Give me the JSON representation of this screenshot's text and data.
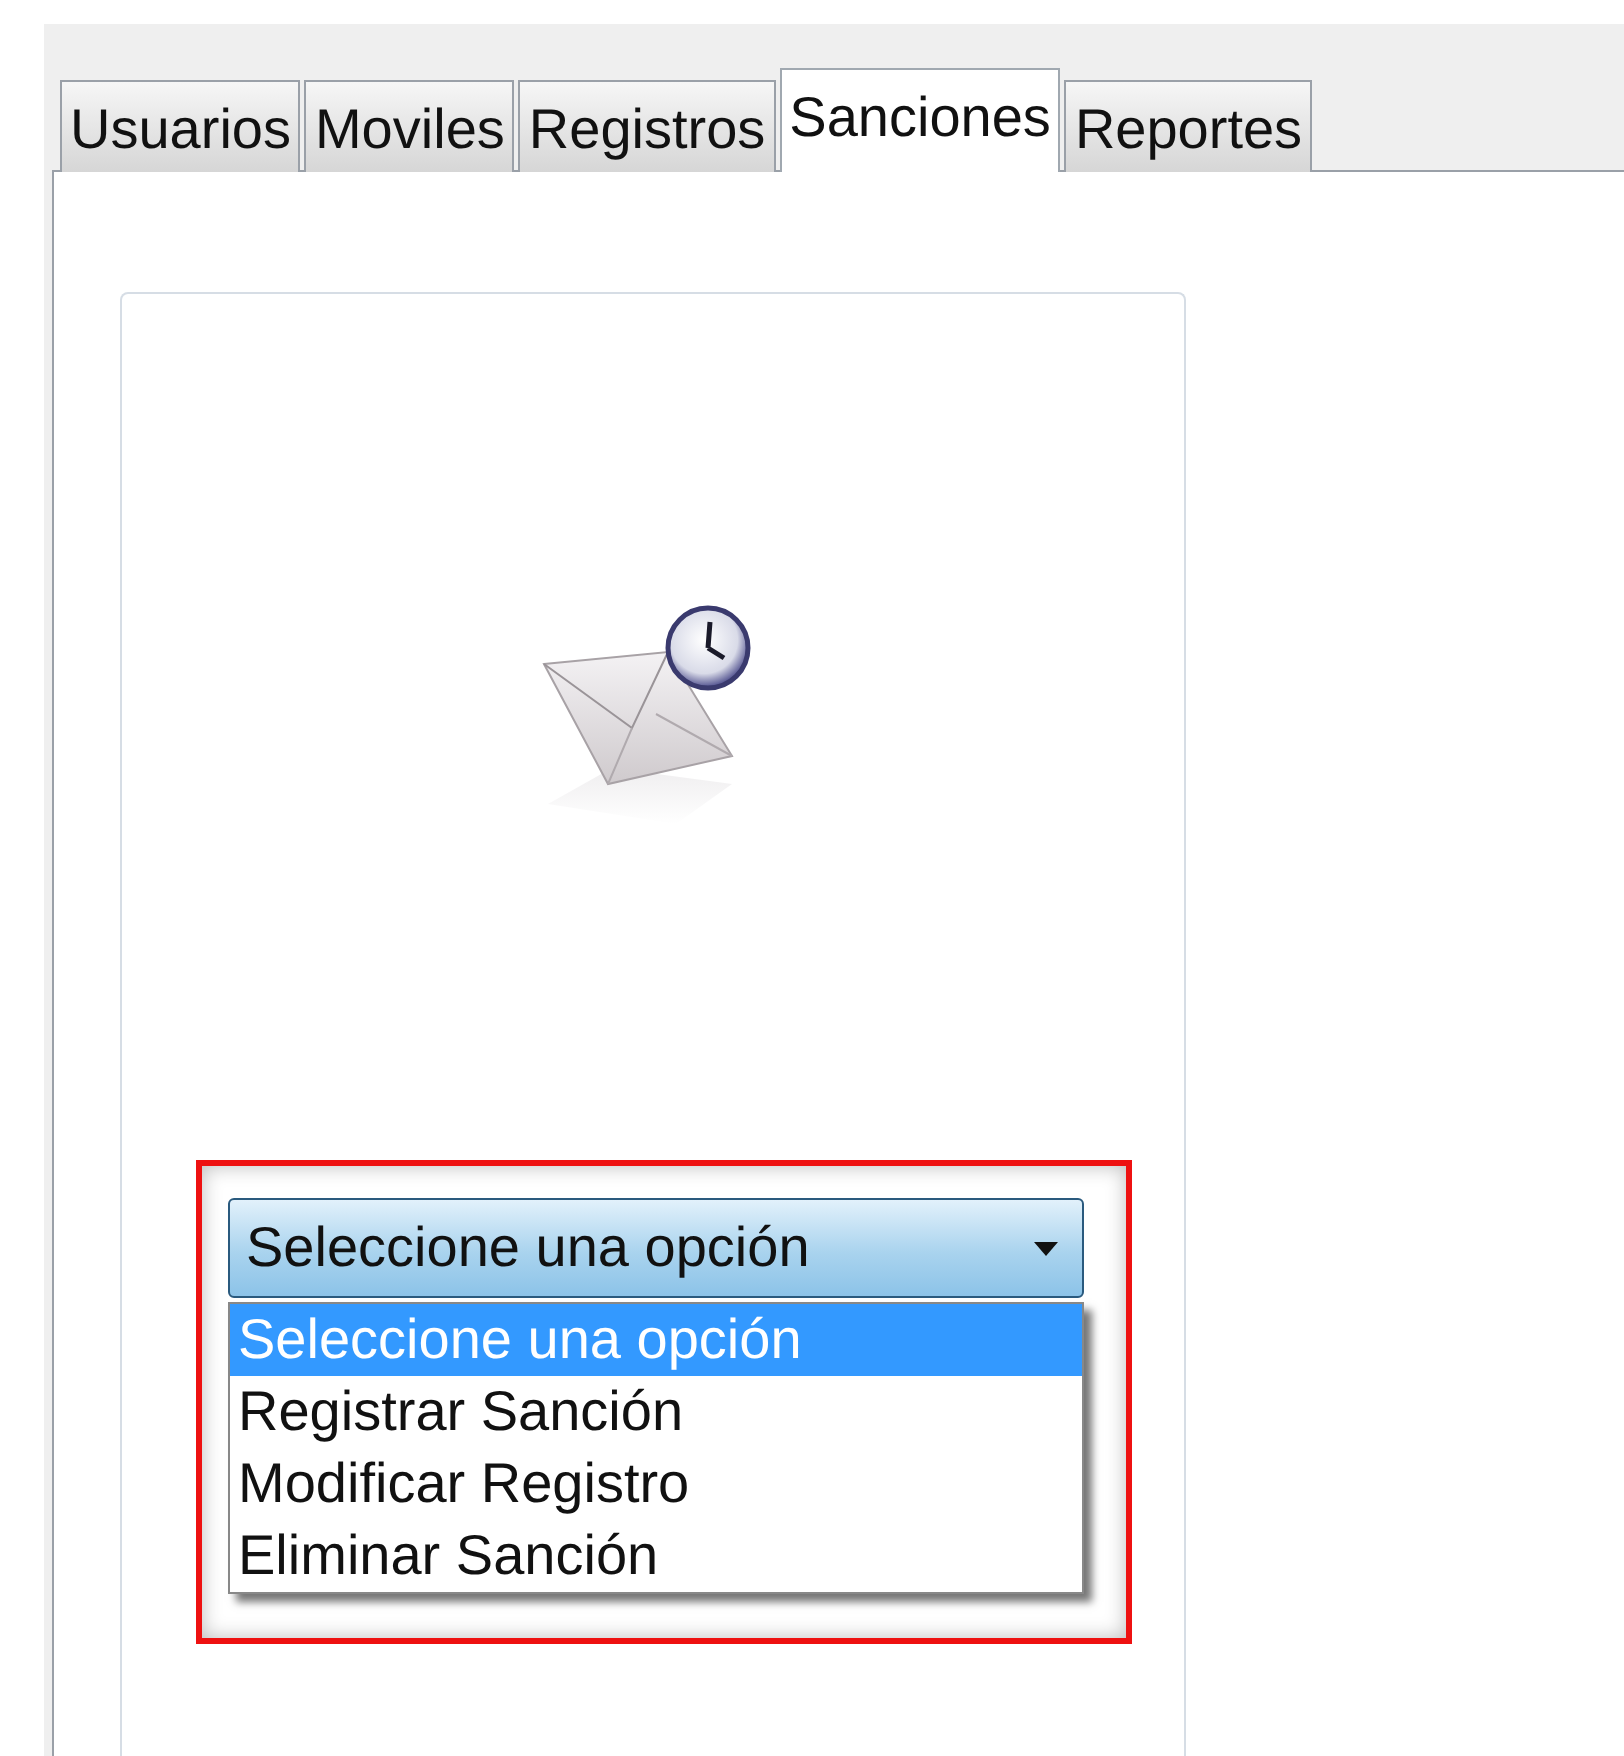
{
  "tabs": [
    {
      "label": "Usuarios",
      "selected": false
    },
    {
      "label": "Moviles",
      "selected": false
    },
    {
      "label": "Registros",
      "selected": false
    },
    {
      "label": "Sanciones",
      "selected": true
    },
    {
      "label": "Reportes",
      "selected": false
    }
  ],
  "dropdown": {
    "value": "Seleccione una opción",
    "expanded": true,
    "options": [
      {
        "label": "Seleccione una opción",
        "selected": true
      },
      {
        "label": "Registrar Sanción",
        "selected": false
      },
      {
        "label": "Modificar Registro",
        "selected": false
      },
      {
        "label": "Eliminar Sanción",
        "selected": false
      }
    ]
  }
}
